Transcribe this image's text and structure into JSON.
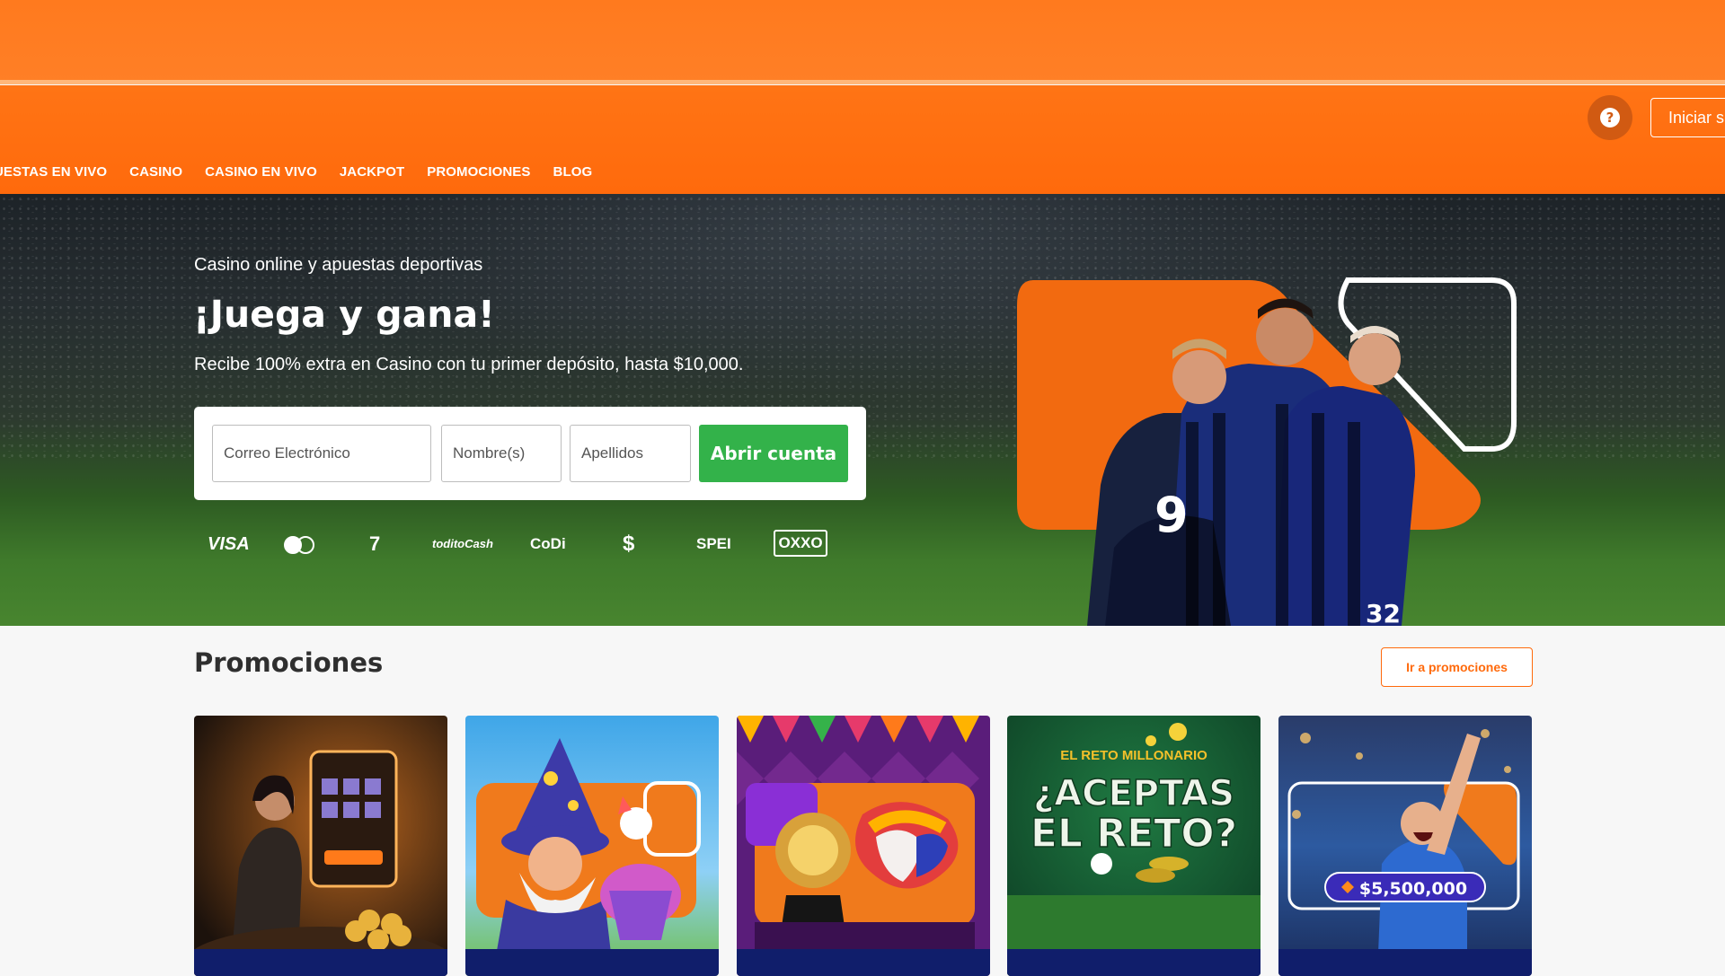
{
  "header": {
    "help_icon": "question-icon",
    "login_label": "Iniciar s"
  },
  "nav": {
    "items": [
      "UESTAS EN VIVO",
      "CASINO",
      "CASINO EN VIVO",
      "JACKPOT",
      "PROMOCIONES",
      "BLOG"
    ]
  },
  "hero": {
    "subtitle": "Casino online y apuestas deportivas",
    "title": "¡Juega y gana!",
    "description": "Recibe 100% extra en Casino con tu primer depósito, hasta $10,000.",
    "form": {
      "email_placeholder": "Correo Electrónico",
      "name_placeholder": "Nombre(s)",
      "lastname_placeholder": "Apellidos",
      "submit_label": "Abrir cuenta"
    },
    "payments": [
      "VISA",
      "mastercard-icon",
      "7",
      "toditoCash",
      "CoDi",
      "$",
      "SPEI",
      "OXXO"
    ],
    "players": [
      "9",
      "32"
    ]
  },
  "promotions": {
    "title": "Promociones",
    "button_label": "Ir a promociones",
    "cards": [
      {
        "icon": "casino-woman-card"
      },
      {
        "icon": "wizard-slots-card"
      },
      {
        "icon": "jester-jackpot-card"
      },
      {
        "heading": "EL RETO MILLONARIO",
        "big_text": "¿ACEPTAS",
        "big_text_2": "EL RETO?"
      },
      {
        "amount": "$5,500,000"
      }
    ]
  },
  "colors": {
    "brand_orange": "#ff6a0c",
    "cta_green": "#33b24a",
    "promo_navy": "#101e6b"
  }
}
